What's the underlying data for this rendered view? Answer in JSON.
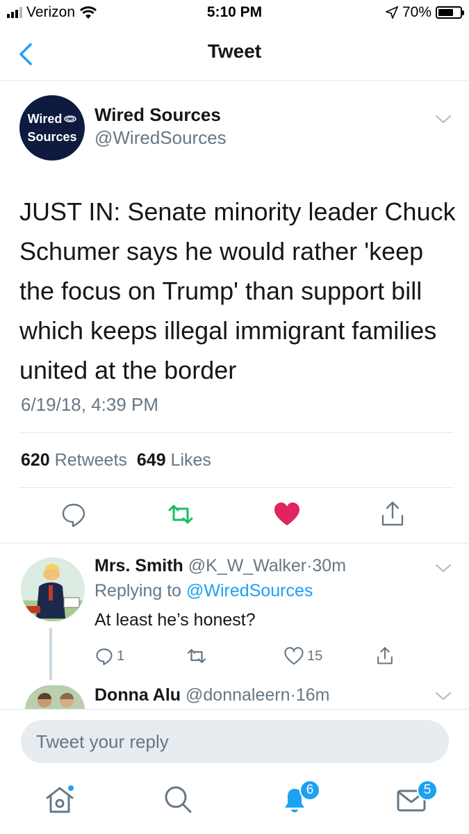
{
  "status_bar": {
    "carrier": "Verizon",
    "time": "5:10 PM",
    "battery_percent_label": "70%",
    "battery_level": 0.7
  },
  "nav": {
    "title": "Tweet"
  },
  "tweet": {
    "avatar_text_line1": "Wired",
    "avatar_text_line2": "Sources",
    "author_name": "Wired Sources",
    "author_handle": "@WiredSources",
    "text": "JUST IN: Senate minority leader Chuck Schumer says he would rather 'keep the focus on Trump' than support bill which keeps illegal immigrant families united at the border",
    "timestamp": "6/19/18, 4:39 PM",
    "retweet_count": "620",
    "retweet_label": "Retweets",
    "like_count": "649",
    "like_label": "Likes",
    "liked": true
  },
  "replies": [
    {
      "name": "Mrs. Smith",
      "handle": "@K_W_Walker",
      "separator": "·",
      "time": "30m",
      "replying_prefix": "Replying to",
      "replying_to": "@WiredSources",
      "text": "At least he’s honest?",
      "reply_count": "1",
      "like_count": "15"
    },
    {
      "name": "Donna Alu",
      "handle": "@donnaleern",
      "separator": "·",
      "time": "16m"
    }
  ],
  "compose": {
    "placeholder": "Tweet your reply"
  },
  "tab_bar": {
    "notifications_badge": "6",
    "messages_badge": "5"
  },
  "colors": {
    "brand_blue": "#1da1f2",
    "like_red": "#e0245e",
    "retweet_green": "#17bf63",
    "secondary_text": "#657786"
  }
}
